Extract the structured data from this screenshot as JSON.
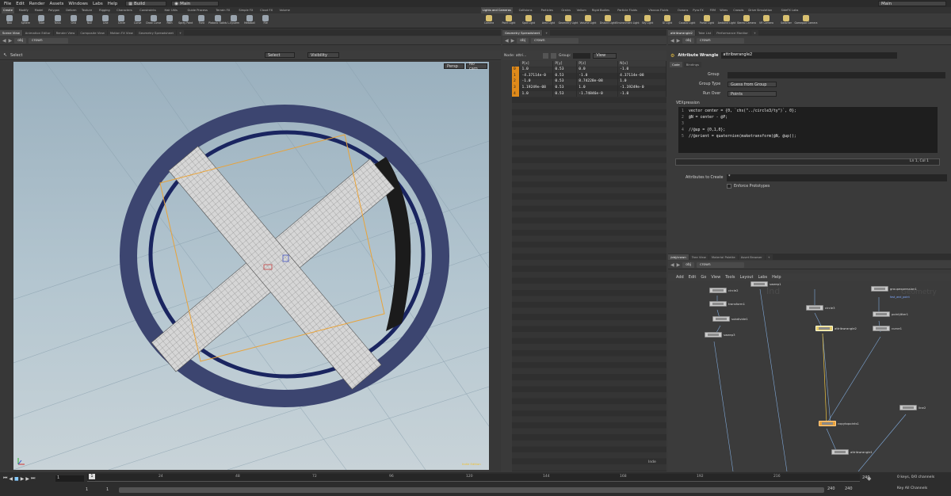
{
  "menubar": {
    "items": [
      "File",
      "Edit",
      "Render",
      "Assets",
      "Windows",
      "Labs",
      "Help"
    ],
    "desktop": "Build",
    "takes": "Main",
    "right_dd": "Main"
  },
  "shelf": {
    "left_tabs": [
      "Create",
      "Modify",
      "Model",
      "Polygon",
      "Deform",
      "Texture",
      "Rigging",
      "Characters",
      "Constraints",
      "Hair Utils",
      "Guide Process",
      "Terrain FX",
      "Simple FX",
      "Cloud FX",
      "Volume"
    ],
    "right_tabs": [
      "Lights and Cameras",
      "Collisions",
      "Particles",
      "Grains",
      "Vellum",
      "Rigid Bodies",
      "Particle Fluids",
      "Viscous Fluids",
      "Oceans",
      "Pyro FX",
      "FEM",
      "Wires",
      "Crowds",
      "Drive Simulation",
      "SideFX Labs"
    ],
    "left_tools": [
      "Box",
      "Sphere",
      "Tube",
      "Torus",
      "Grid",
      "Null",
      "Line",
      "Circle",
      "Curve",
      "Draw Curve",
      "Path",
      "Spray Paint",
      "Font",
      "Platonic Solids",
      "L-System",
      "Metaball",
      "File"
    ],
    "right_tools": [
      "Camera",
      "Point Light",
      "Spot Light",
      "Area Light",
      "Geometry Light",
      "Volume Light",
      "Distant Light",
      "Environment Light",
      "Sky Light",
      "GI Light",
      "Caustic Light",
      "Portal Light",
      "Ambient Light",
      "Stereo Camera",
      "VR Camera",
      "Switcher",
      "Gamepad Camera"
    ]
  },
  "viewer": {
    "tabs": [
      "Scene View",
      "Animation Editor",
      "Render View",
      "Composite View",
      "Motion FX View",
      "Geometry Spreadsheet"
    ],
    "path": [
      "obj",
      "crown"
    ],
    "select_label": "Select",
    "select_dd": "Select",
    "visibility_dd": "Visibility",
    "persp": "Persp",
    "cam": "No cam",
    "corner_label": "Indie Edition"
  },
  "spreadsheet": {
    "tabs": [
      "Geometry Spreadsheet"
    ],
    "path": [
      "obj",
      "crown"
    ],
    "node_label": "Node: attri...",
    "group_label": "Group:",
    "view_label": "View",
    "columns": [
      "",
      "P[x]",
      "P[y]",
      "P[z]",
      "N[x]"
    ],
    "rows": [
      [
        "0",
        "1.0",
        "0.53",
        "0.0",
        "-1.0"
      ],
      [
        "1",
        "-4.37114e-0",
        "0.53",
        "-1.0",
        "4.37114e-08"
      ],
      [
        "2",
        "-1.0",
        "0.53",
        "8.74228e-08",
        "1.0"
      ],
      [
        "3",
        "1.19249e-08",
        "0.53",
        "1.0",
        "-1.19249e-0"
      ],
      [
        "4",
        "1.0",
        "0.53",
        "-1.74846e-0",
        "-1.0"
      ]
    ],
    "footer": "Inde"
  },
  "params": {
    "tabs": [
      "attribwrangle2",
      "Take List",
      "Performance Monitor"
    ],
    "path": [
      "obj",
      "crown"
    ],
    "node_type": "Attribute Wrangle",
    "node_name": "attribwrangle2",
    "subtabs": [
      "Code",
      "Bindings"
    ],
    "group_label": "Group",
    "group_type_label": "Group Type",
    "group_type": "Guess from Group",
    "run_over_label": "Run Over",
    "run_over": "Points",
    "vex_label": "VEXpression",
    "code": [
      {
        "n": "1",
        "t": "vector center = {0, `chs(\"../circle3/ty\")`, 0};"
      },
      {
        "n": "2",
        "t": "@N = center - @P;"
      },
      {
        "n": "3",
        "t": ""
      },
      {
        "n": "4",
        "t": "//@up = {0,1,0};"
      },
      {
        "n": "5",
        "t": "//@orient = quaternion(maketransform(@N, @up));"
      }
    ],
    "cursor_pos": "Ln 1, Col 1",
    "attr_create_label": "Attributes to Create",
    "attr_create_value": "*",
    "enforce_label": "Enforce Prototypes"
  },
  "network": {
    "tabs": [
      "/obj/crown",
      "Tree View",
      "Material Palette",
      "Asset Browser"
    ],
    "path": [
      "obj",
      "crown"
    ],
    "menu": [
      "Add",
      "Edit",
      "Go",
      "View",
      "Tools",
      "Layout",
      "Labs",
      "Help"
    ],
    "watermark_left": "Ind",
    "watermark_right": "Geometry",
    "nodes": [
      "circle2",
      "transform1",
      "subdivide1",
      "sweep3",
      "sweep1",
      "circle3",
      "attribwrangle2",
      "groupexpression1",
      "pointjitter1",
      "curve1",
      "line2",
      "copytopoints1",
      "attribwrangle1"
    ],
    "node_note": "fast_and_point"
  },
  "timeline": {
    "start_frame": "1",
    "current_frame": "1",
    "range_start": "1",
    "range_end": "240",
    "end_frame": "240",
    "end_frame2": "240",
    "ticks": [
      "24",
      "48",
      "72",
      "96",
      "120",
      "144",
      "168",
      "192",
      "216"
    ],
    "keys_label": "0 keys, 0/0 channels",
    "key_all_label": "Key All Channels"
  },
  "colors": {
    "selected_node": "#e9a23b",
    "point_highlight": "#e08a1a"
  }
}
